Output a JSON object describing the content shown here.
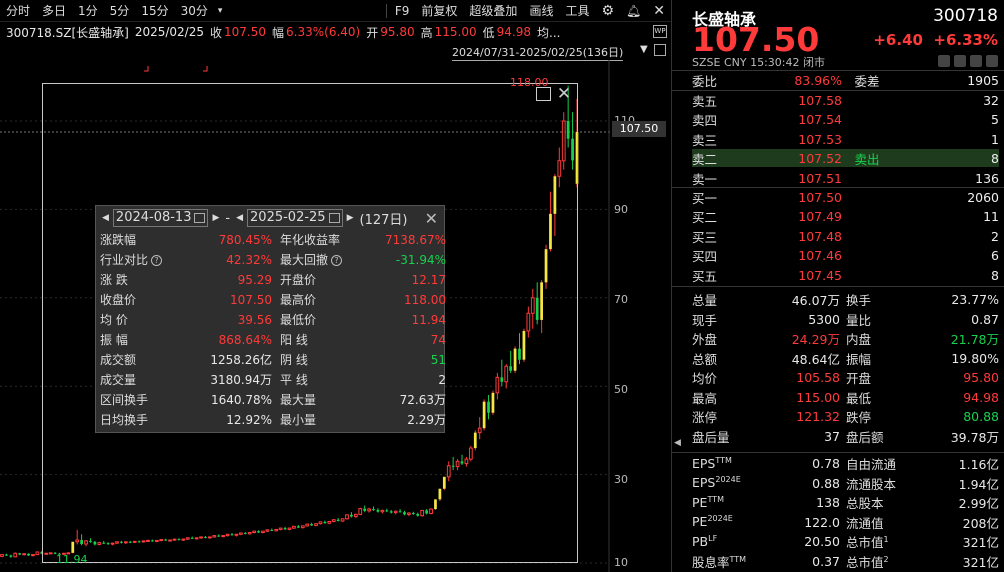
{
  "toolbar": {
    "items": [
      "分时",
      "多日",
      "1分",
      "5分",
      "15分",
      "30分"
    ],
    "more": "▾",
    "right_items": [
      "F9",
      "前复权",
      "超级叠加",
      "画线",
      "工具"
    ]
  },
  "info_bar": {
    "code": "300718.SZ[长盛轴承]",
    "date": "2025/02/25",
    "close_label": "收",
    "close": "107.50",
    "amp_label": "幅",
    "amp": "6.33%(6.40)",
    "open_label": "开",
    "open": "95.80",
    "high_label": "高",
    "high": "115.00",
    "low_label": "低",
    "low": "94.98",
    "avg_label": "均..."
  },
  "range_label": "2024/07/31-2025/02/25(136日)",
  "axis": {
    "ticks": [
      "110",
      "90",
      "70",
      "50",
      "30",
      "10"
    ],
    "last_price": "107.50",
    "box_max": "118.00",
    "min_marker": "11.94"
  },
  "stats_popup": {
    "start_date": "2024-08-13",
    "end_date": "2025-02-25",
    "dash": "-",
    "days": "(127日)",
    "rows": [
      {
        "l1": "涨跌幅",
        "v1": "780.45%",
        "c1": "red",
        "l2": "年化收益率",
        "v2": "7138.67%",
        "c2": "red"
      },
      {
        "l1": "行业对比",
        "q1": "?",
        "v1": "42.32%",
        "c1": "red",
        "l2": "最大回撤",
        "q2": "?",
        "v2": "-31.94%",
        "c2": "green"
      },
      {
        "l1": "涨    跌",
        "v1": "95.29",
        "c1": "red",
        "l2": "开盘价",
        "v2": "12.17",
        "c2": "red"
      },
      {
        "l1": "收盘价",
        "v1": "107.50",
        "c1": "red",
        "l2": "最高价",
        "v2": "118.00",
        "c2": "red"
      },
      {
        "l1": "均    价",
        "v1": "39.56",
        "c1": "red",
        "l2": "最低价",
        "v2": "11.94",
        "c2": "red"
      },
      {
        "l1": "振    幅",
        "v1": "868.64%",
        "c1": "red",
        "l2": "阳    线",
        "v2": "74",
        "c2": "red"
      },
      {
        "l1": "成交额",
        "v1": "1258.26亿",
        "c1": "white",
        "l2": "阴    线",
        "v2": "51",
        "c2": "green"
      },
      {
        "l1": "成交量",
        "v1": "3180.94万",
        "c1": "white",
        "l2": "平    线",
        "v2": "2",
        "c2": "white"
      },
      {
        "l1": "区间换手",
        "v1": "1640.78%",
        "c1": "white",
        "l2": "最大量",
        "v2": "72.63万",
        "c2": "white"
      },
      {
        "l1": "日均换手",
        "v1": "12.92%",
        "c1": "white",
        "l2": "最小量",
        "v2": "2.29万",
        "c2": "white"
      }
    ]
  },
  "quote": {
    "name": "长盛轴承",
    "code": "300718",
    "price": "107.50",
    "change": "+6.40",
    "change_pct": "+6.33%",
    "meta": "SZSE   CNY   15:30:42   闭市",
    "weibi_label": "委比",
    "weibi": "83.96%",
    "weicha_label": "委差",
    "weicha": "1905",
    "asks": [
      {
        "label": "卖五",
        "price": "107.58",
        "mid": "",
        "vol": "32"
      },
      {
        "label": "卖四",
        "price": "107.54",
        "mid": "",
        "vol": "5"
      },
      {
        "label": "卖三",
        "price": "107.53",
        "mid": "",
        "vol": "1"
      },
      {
        "label": "卖二",
        "price": "107.52",
        "mid": "卖出",
        "vol": "8"
      },
      {
        "label": "卖一",
        "price": "107.51",
        "mid": "",
        "vol": "136"
      }
    ],
    "bids": [
      {
        "label": "买一",
        "price": "107.50",
        "mid": "",
        "vol": "2060"
      },
      {
        "label": "买二",
        "price": "107.49",
        "mid": "",
        "vol": "11"
      },
      {
        "label": "买三",
        "price": "107.48",
        "mid": "",
        "vol": "2"
      },
      {
        "label": "买四",
        "price": "107.46",
        "mid": "",
        "vol": "6"
      },
      {
        "label": "买五",
        "price": "107.45",
        "mid": "",
        "vol": "8"
      }
    ],
    "stats": [
      {
        "l1": "总量",
        "v1": "46.07万",
        "c1": "white",
        "l2": "换手",
        "v2": "23.77%",
        "c2": "white"
      },
      {
        "l1": "现手",
        "v1": "5300",
        "c1": "white",
        "l2": "量比",
        "v2": "0.87",
        "c2": "white"
      },
      {
        "l1": "外盘",
        "v1": "24.29万",
        "c1": "red",
        "l2": "内盘",
        "v2": "21.78万",
        "c2": "green"
      },
      {
        "l1": "总额",
        "v1": "48.64亿",
        "c1": "white",
        "l2": "振幅",
        "v2": "19.80%",
        "c2": "white"
      },
      {
        "l1": "均价",
        "v1": "105.58",
        "c1": "red",
        "l2": "开盘",
        "v2": "95.80",
        "c2": "red"
      },
      {
        "l1": "最高",
        "v1": "115.00",
        "c1": "red",
        "l2": "最低",
        "v2": "94.98",
        "c2": "red"
      },
      {
        "l1": "涨停",
        "v1": "121.32",
        "c1": "red",
        "l2": "跌停",
        "v2": "80.88",
        "c2": "green"
      },
      {
        "l1": "盘后量",
        "v1": "37",
        "c1": "white",
        "l2": "盘后额",
        "v2": "39.78万",
        "c2": "white"
      }
    ],
    "fundamentals": [
      {
        "l1": "EPS",
        "s1": "TTM",
        "v1": "0.78",
        "l2": "自由流通",
        "s2": "",
        "v2": "1.16亿"
      },
      {
        "l1": "EPS",
        "s1": "2024E",
        "v1": "0.88",
        "l2": "流通股本",
        "s2": "",
        "v2": "1.94亿"
      },
      {
        "l1": "PE",
        "s1": "TTM",
        "v1": "138",
        "l2": "总股本",
        "s2": "",
        "v2": "2.99亿"
      },
      {
        "l1": "PE",
        "s1": "2024E",
        "v1": "122.0",
        "l2": "流通值",
        "s2": "",
        "v2": "208亿"
      },
      {
        "l1": "PB",
        "s1": "LF",
        "v1": "20.50",
        "l2": "总市值",
        "s2": "1",
        "v2": "321亿"
      },
      {
        "l1": "股息率",
        "s1": "TTM",
        "v1": "0.37",
        "l2": "总市值",
        "s2": "2",
        "v2": "321亿"
      }
    ]
  },
  "chart_data": {
    "type": "candlestick",
    "ylim": [
      8,
      122
    ],
    "yticks": [
      10,
      30,
      50,
      70,
      90,
      110
    ],
    "candles": [
      [
        11.5,
        12.0,
        11.3,
        11.9
      ],
      [
        11.9,
        12.1,
        11.6,
        11.7
      ],
      [
        11.7,
        11.9,
        11.2,
        11.4
      ],
      [
        11.4,
        12.4,
        11.3,
        12.2
      ],
      [
        12.2,
        12.3,
        11.8,
        11.9
      ],
      [
        11.9,
        12.2,
        11.7,
        12.1
      ],
      [
        12.1,
        12.2,
        11.6,
        11.7
      ],
      [
        11.7,
        12.0,
        11.5,
        11.9
      ],
      [
        11.9,
        12.6,
        11.8,
        12.5
      ],
      [
        12.5,
        12.7,
        12.0,
        12.1
      ],
      [
        12.1,
        12.3,
        11.9,
        12.2
      ],
      [
        12.2,
        12.4,
        12.0,
        12.3
      ],
      [
        12.3,
        12.5,
        12.0,
        12.1
      ],
      [
        12.1,
        12.3,
        11.9,
        12.0
      ],
      [
        12.0,
        12.2,
        11.8,
        12.2
      ],
      [
        12.2,
        12.4,
        12.0,
        12.3
      ],
      [
        12.3,
        14.8,
        12.2,
        14.8
      ],
      [
        14.8,
        17.5,
        14.2,
        15.2
      ],
      [
        15.2,
        16.5,
        14.0,
        14.3
      ],
      [
        14.3,
        15.2,
        13.8,
        15.0
      ],
      [
        15.0,
        15.6,
        14.6,
        14.8
      ],
      [
        14.8,
        15.0,
        14.0,
        14.2
      ],
      [
        14.2,
        14.8,
        14.0,
        14.6
      ],
      [
        14.6,
        15.0,
        14.3,
        14.5
      ],
      [
        14.5,
        14.7,
        14.1,
        14.3
      ],
      [
        14.3,
        14.6,
        14.0,
        14.5
      ],
      [
        14.5,
        14.9,
        14.3,
        14.8
      ],
      [
        14.8,
        15.0,
        14.4,
        14.6
      ],
      [
        14.6,
        14.9,
        14.3,
        14.8
      ],
      [
        14.8,
        15.0,
        14.5,
        14.7
      ],
      [
        14.7,
        15.0,
        14.5,
        14.9
      ],
      [
        14.9,
        15.1,
        14.6,
        14.8
      ],
      [
        14.8,
        15.1,
        14.6,
        15.0
      ],
      [
        15.0,
        15.3,
        14.8,
        15.1
      ],
      [
        15.1,
        15.3,
        14.8,
        14.9
      ],
      [
        14.9,
        15.2,
        14.7,
        15.1
      ],
      [
        15.1,
        15.4,
        14.9,
        15.3
      ],
      [
        15.3,
        15.5,
        15.0,
        15.1
      ],
      [
        15.1,
        15.3,
        14.9,
        15.2
      ],
      [
        15.2,
        15.5,
        15.0,
        15.4
      ],
      [
        15.4,
        15.6,
        15.1,
        15.2
      ],
      [
        15.2,
        15.5,
        15.0,
        15.4
      ],
      [
        15.4,
        15.8,
        15.2,
        15.7
      ],
      [
        15.7,
        16.0,
        15.4,
        15.5
      ],
      [
        15.5,
        15.8,
        15.3,
        15.7
      ],
      [
        15.7,
        16.0,
        15.5,
        15.9
      ],
      [
        15.9,
        16.1,
        15.6,
        15.7
      ],
      [
        15.7,
        16.0,
        15.5,
        15.9
      ],
      [
        15.9,
        16.3,
        15.7,
        16.2
      ],
      [
        16.2,
        16.5,
        15.9,
        16.0
      ],
      [
        16.0,
        16.3,
        15.8,
        16.2
      ],
      [
        16.2,
        16.6,
        16.0,
        16.5
      ],
      [
        16.5,
        16.8,
        16.2,
        16.3
      ],
      [
        16.3,
        16.6,
        16.0,
        16.5
      ],
      [
        16.5,
        16.9,
        16.3,
        16.8
      ],
      [
        16.8,
        17.0,
        16.5,
        16.6
      ],
      [
        16.6,
        17.0,
        16.4,
        16.9
      ],
      [
        16.9,
        17.3,
        16.7,
        17.2
      ],
      [
        17.2,
        17.4,
        16.8,
        16.9
      ],
      [
        16.9,
        17.3,
        16.7,
        17.2
      ],
      [
        17.2,
        17.6,
        17.0,
        17.5
      ],
      [
        17.5,
        17.8,
        17.2,
        17.3
      ],
      [
        17.3,
        17.7,
        17.1,
        17.6
      ],
      [
        17.6,
        18.0,
        17.4,
        17.9
      ],
      [
        17.9,
        18.2,
        17.5,
        17.6
      ],
      [
        17.6,
        18.0,
        17.4,
        17.9
      ],
      [
        17.9,
        18.4,
        17.7,
        18.3
      ],
      [
        18.3,
        18.6,
        17.9,
        18.0
      ],
      [
        18.0,
        18.5,
        17.8,
        18.4
      ],
      [
        18.4,
        18.9,
        18.2,
        18.8
      ],
      [
        18.8,
        19.1,
        18.4,
        18.5
      ],
      [
        18.5,
        19.0,
        18.3,
        18.9
      ],
      [
        18.9,
        19.4,
        18.7,
        19.3
      ],
      [
        19.3,
        19.6,
        18.9,
        19.0
      ],
      [
        19.0,
        19.5,
        18.8,
        19.4
      ],
      [
        19.4,
        19.9,
        19.2,
        19.8
      ],
      [
        19.8,
        20.2,
        19.4,
        19.5
      ],
      [
        19.5,
        20.1,
        19.3,
        20.0
      ],
      [
        20.0,
        21.0,
        19.8,
        20.9
      ],
      [
        20.9,
        21.5,
        20.3,
        20.5
      ],
      [
        20.5,
        21.2,
        20.2,
        21.0
      ],
      [
        21.0,
        22.5,
        20.8,
        22.3
      ],
      [
        22.3,
        23.0,
        21.5,
        21.8
      ],
      [
        21.8,
        22.5,
        21.4,
        22.2
      ],
      [
        22.2,
        22.8,
        21.8,
        22.0
      ],
      [
        22.0,
        22.4,
        21.4,
        21.6
      ],
      [
        21.6,
        22.1,
        21.2,
        21.9
      ],
      [
        21.9,
        22.3,
        21.5,
        21.7
      ],
      [
        21.7,
        22.0,
        21.2,
        21.4
      ],
      [
        21.4,
        21.9,
        21.0,
        21.7
      ],
      [
        21.7,
        22.2,
        21.4,
        21.5
      ],
      [
        21.5,
        21.8,
        20.8,
        21.0
      ],
      [
        21.0,
        21.5,
        20.6,
        21.3
      ],
      [
        21.3,
        21.6,
        20.9,
        21.1
      ],
      [
        21.1,
        21.4,
        20.5,
        20.7
      ],
      [
        20.7,
        22.0,
        20.5,
        21.9
      ],
      [
        21.9,
        22.2,
        21.0,
        21.2
      ],
      [
        21.2,
        22.4,
        21.0,
        22.2
      ],
      [
        22.2,
        24.4,
        22.0,
        24.4
      ],
      [
        24.4,
        26.8,
        24.0,
        26.8
      ],
      [
        26.8,
        29.5,
        26.5,
        29.5
      ],
      [
        29.5,
        33.0,
        28.5,
        32.0
      ],
      [
        32.0,
        34.0,
        31.0,
        31.8
      ],
      [
        31.8,
        33.5,
        31.0,
        33.0
      ],
      [
        33.0,
        34.5,
        32.2,
        32.5
      ],
      [
        32.5,
        34.0,
        31.8,
        33.5
      ],
      [
        33.5,
        36.5,
        33.0,
        36.0
      ],
      [
        36.0,
        40.0,
        35.5,
        39.5
      ],
      [
        39.5,
        43.0,
        38.0,
        40.5
      ],
      [
        40.5,
        47.0,
        40.0,
        46.5
      ],
      [
        46.5,
        48.0,
        42.5,
        44.0
      ],
      [
        44.0,
        49.0,
        43.5,
        48.5
      ],
      [
        48.5,
        53.0,
        47.0,
        52.0
      ],
      [
        52.0,
        56.0,
        50.0,
        51.0
      ],
      [
        51.0,
        55.0,
        49.5,
        54.5
      ],
      [
        54.5,
        58.0,
        53.0,
        53.5
      ],
      [
        53.5,
        59.0,
        53.0,
        58.5
      ],
      [
        58.5,
        62.0,
        55.0,
        56.0
      ],
      [
        56.0,
        63.0,
        55.5,
        62.5
      ],
      [
        62.5,
        68.0,
        61.0,
        66.5
      ],
      [
        66.5,
        72.0,
        63.0,
        70.0
      ],
      [
        70.0,
        73.5,
        64.0,
        65.0
      ],
      [
        65.0,
        74.0,
        62.0,
        73.5
      ],
      [
        73.5,
        82.0,
        72.0,
        81.0
      ],
      [
        81.0,
        94.0,
        80.5,
        89.0
      ],
      [
        89.0,
        98.0,
        84.0,
        97.5
      ],
      [
        97.5,
        104.0,
        95.0,
        101.0
      ],
      [
        101.0,
        112.0,
        99.0,
        110.0
      ],
      [
        110.0,
        118.0,
        104.0,
        106.0
      ],
      [
        106.0,
        112.0,
        99.0,
        101.1
      ],
      [
        95.8,
        115.0,
        94.98,
        107.5
      ]
    ]
  }
}
